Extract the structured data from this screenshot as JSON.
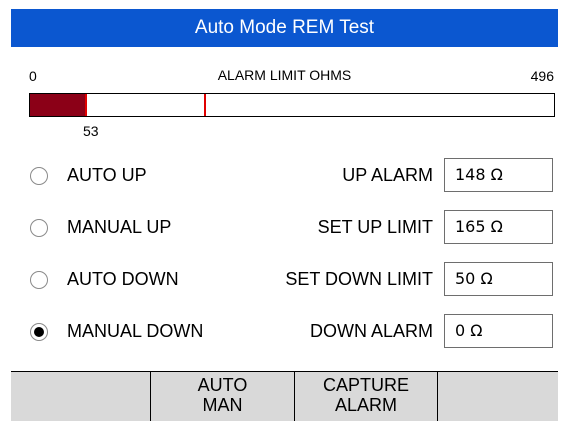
{
  "title": "Auto Mode REM Test",
  "gauge": {
    "title": "ALARM LIMIT OHMS",
    "min_label": "0",
    "max_label": "496",
    "max_value": 496,
    "fill_value": 53,
    "fill_label": "53",
    "limit_marker_value": 165,
    "fill_color": "#8b0017",
    "marker_color": "#e00000"
  },
  "modes": [
    {
      "label": "AUTO UP",
      "selected": false
    },
    {
      "label": "MANUAL UP",
      "selected": false
    },
    {
      "label": "AUTO DOWN",
      "selected": false
    },
    {
      "label": "MANUAL DOWN",
      "selected": true
    }
  ],
  "fields": [
    {
      "label": "UP ALARM",
      "value": "148 Ω"
    },
    {
      "label": "SET UP LIMIT",
      "value": "165 Ω"
    },
    {
      "label": "SET DOWN LIMIT",
      "value": "50 Ω"
    },
    {
      "label": "DOWN ALARM",
      "value": "0 Ω"
    }
  ],
  "softkeys": [
    {
      "line1": "",
      "line2": ""
    },
    {
      "line1": "AUTO",
      "line2": "MAN"
    },
    {
      "line1": "CAPTURE",
      "line2": "ALARM"
    },
    {
      "line1": "",
      "line2": ""
    }
  ],
  "colors": {
    "titlebar": "#0b57d0",
    "softkey_bg": "#d9d9d9"
  }
}
